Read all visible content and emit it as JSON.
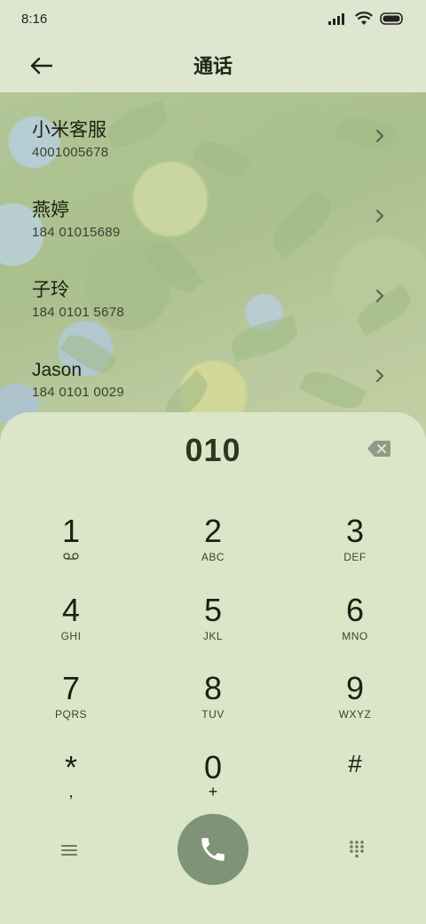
{
  "status_bar": {
    "time": "8:16",
    "icons": [
      "signal-icon",
      "wifi-icon",
      "battery-icon"
    ]
  },
  "header": {
    "title": "通话",
    "back_icon": "arrow-left-icon"
  },
  "contacts": [
    {
      "name": "小米客服",
      "number": "4001005678"
    },
    {
      "name": "燕婷",
      "number": "184 01015689"
    },
    {
      "name": "子玲",
      "number": "184 0101 5678"
    },
    {
      "name": "Jason",
      "number": "184 0101 0029"
    }
  ],
  "dialer": {
    "input_value": "010",
    "backspace_icon": "backspace-icon",
    "keys": [
      {
        "digit": "1",
        "letters": ""
      },
      {
        "digit": "2",
        "letters": "ABC"
      },
      {
        "digit": "3",
        "letters": "DEF"
      },
      {
        "digit": "4",
        "letters": "GHI"
      },
      {
        "digit": "5",
        "letters": "JKL"
      },
      {
        "digit": "6",
        "letters": "MNO"
      },
      {
        "digit": "7",
        "letters": "PQRS"
      },
      {
        "digit": "8",
        "letters": "TUV"
      },
      {
        "digit": "9",
        "letters": "WXYZ"
      },
      {
        "digit": "*",
        "letters": ","
      },
      {
        "digit": "0",
        "letters": "+"
      },
      {
        "digit": "#",
        "letters": ""
      }
    ],
    "bottom": {
      "menu_icon": "menu-icon",
      "call_icon": "phone-icon",
      "keypad_icon": "dialpad-icon"
    }
  },
  "colors": {
    "background": "#dfe6cf",
    "call_button": "#7f9378",
    "text": "#1f2418"
  }
}
